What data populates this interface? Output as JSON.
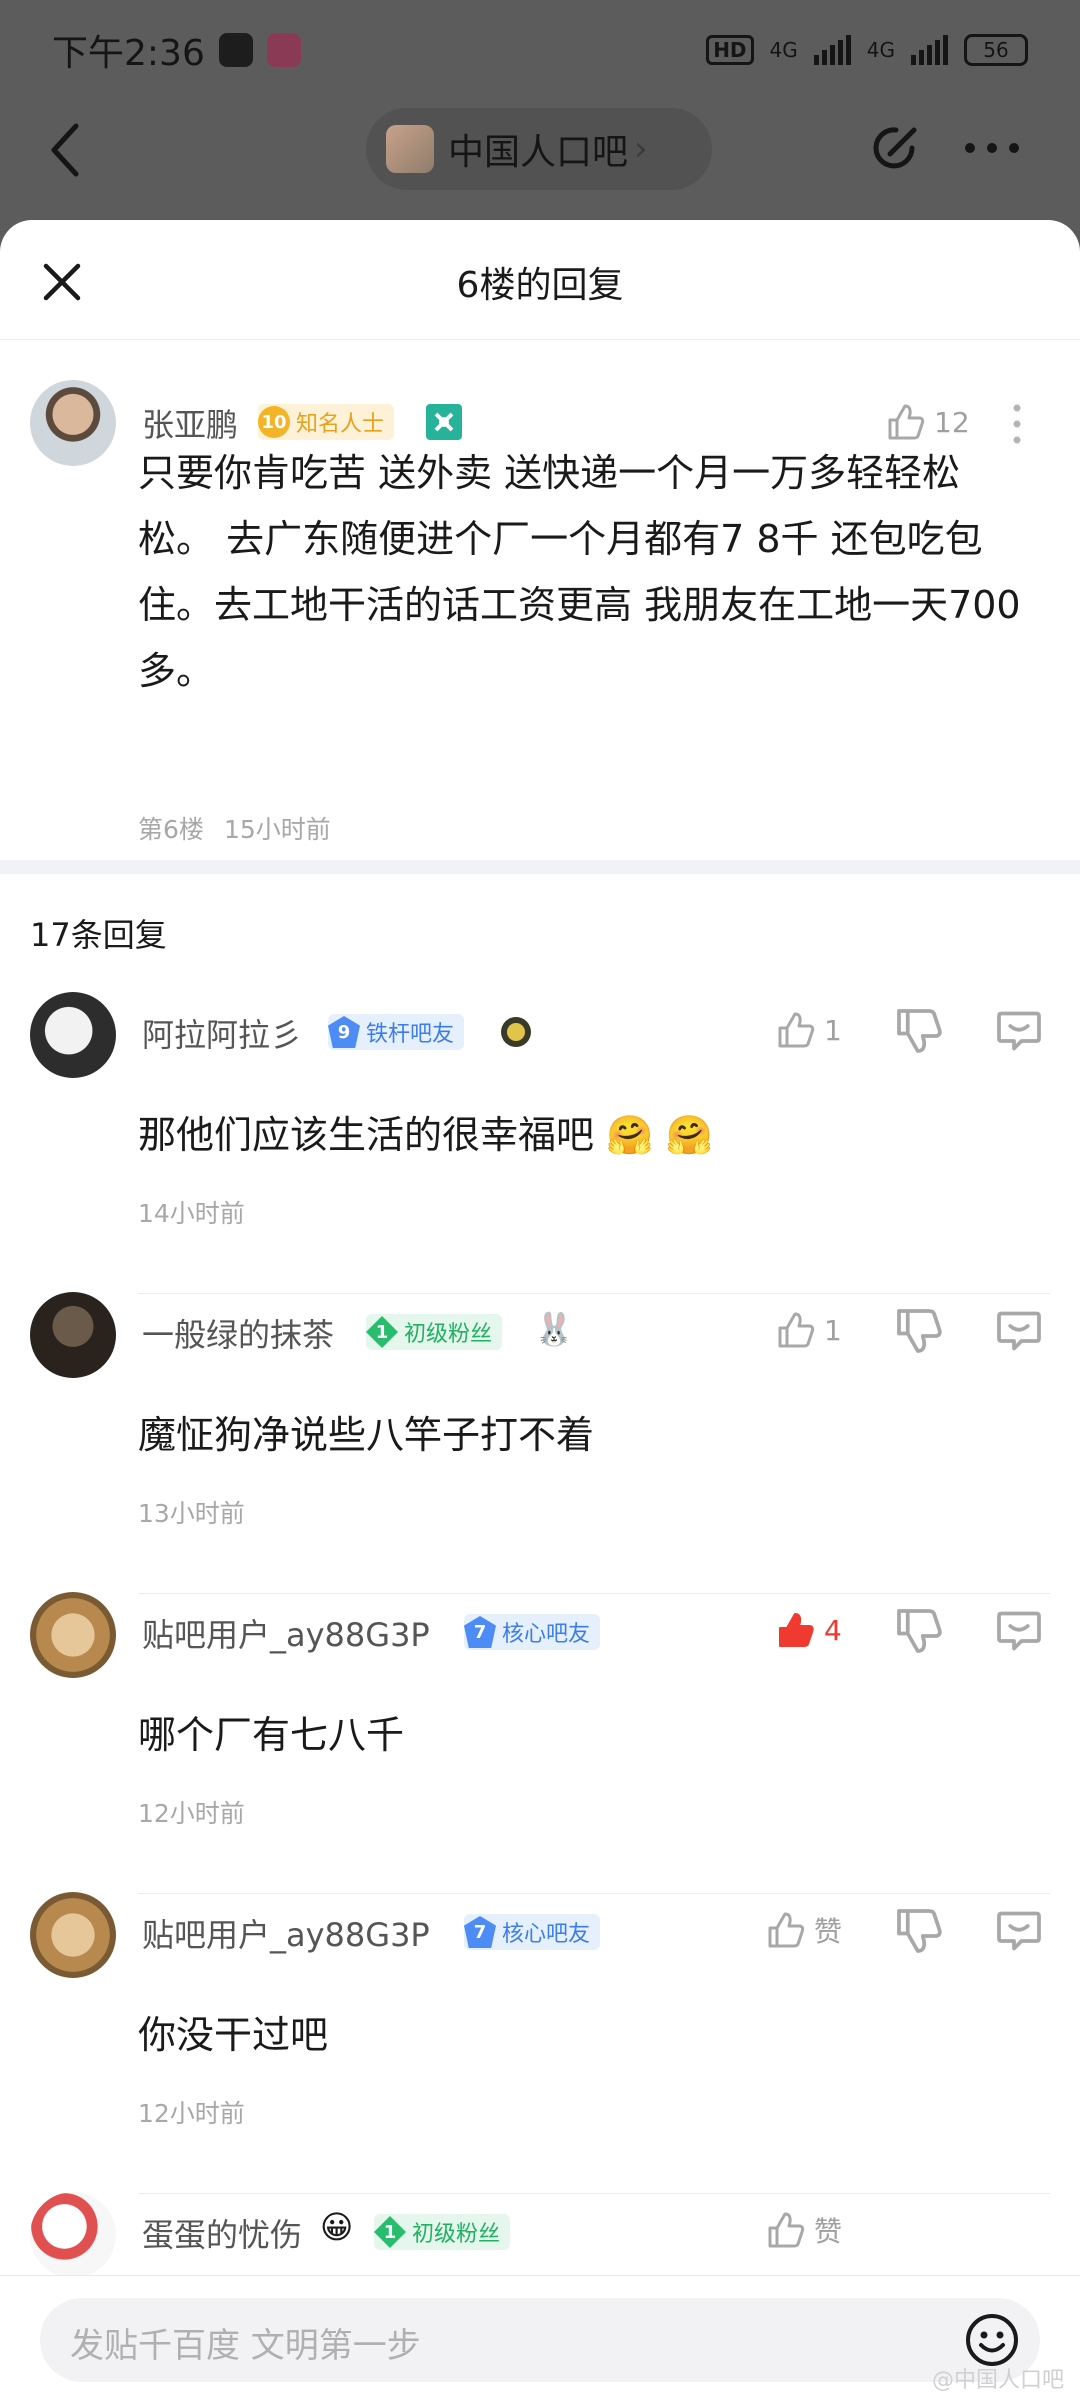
{
  "status_bar": {
    "time": "下午2:36",
    "network1": "4G",
    "network2": "4G",
    "hd": "HD",
    "battery": "56"
  },
  "nav": {
    "forum_name": "中国人口吧",
    "chevron": "›"
  },
  "sheet": {
    "title": "6楼的回复"
  },
  "main_post": {
    "username": "张亚鹏",
    "badge_level": "10",
    "badge_label": "知名人士",
    "like_count": "12",
    "content": "只要你肯吃苦 送外卖 送快递一个月一万多轻轻松松。 去广东随便进个厂一个月都有7 8千 还包吃包住。去工地干活的话工资更高 我朋友在工地一天700多。",
    "floor": "第6楼",
    "time": "15小时前"
  },
  "replies_count": "17条回复",
  "replies": [
    {
      "username": "阿拉阿拉彡",
      "badge_level": "9",
      "badge_label": "铁杆吧友",
      "like": "1",
      "text": "那他们应该生活的很幸福吧",
      "time": "14小时前",
      "liked": false
    },
    {
      "username": "一般绿的抹茶",
      "badge_level": "1",
      "badge_label": "初级粉丝",
      "like": "1",
      "text": "魔怔狗净说些八竿子打不着",
      "time": "13小时前",
      "liked": false
    },
    {
      "username": "贴吧用户_ay88G3P",
      "badge_level": "7",
      "badge_label": "核心吧友",
      "like": "4",
      "text": "哪个厂有七八千",
      "time": "12小时前",
      "liked": true
    },
    {
      "username": "贴吧用户_ay88G3P",
      "badge_level": "7",
      "badge_label": "核心吧友",
      "like": "赞",
      "text": "你没干过吧",
      "time": "12小时前",
      "liked": false
    },
    {
      "username": "蛋蛋的忧伤",
      "badge_level": "1",
      "badge_label": "初级粉丝",
      "like": "赞"
    }
  ],
  "compose": {
    "placeholder": "发贴千百度 文明第一步"
  },
  "watermark": "@中国人口吧",
  "colors": {
    "liked_red": "#f03a2f",
    "icon_gray": "#b5b5b5"
  }
}
